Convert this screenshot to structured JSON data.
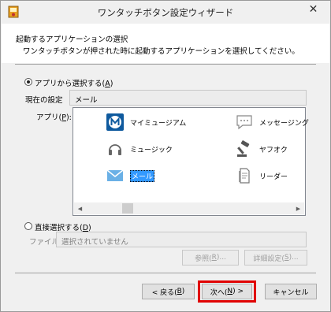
{
  "window": {
    "title": "ワンタッチボタン設定ウィザード",
    "close_glyph": "✕"
  },
  "header": {
    "title": "起動するアプリケーションの選択",
    "subtitle": "ワンタッチボタンが押された時に起動するアプリケーションを選択してください。"
  },
  "app_option": {
    "label": "アプリから選択する(",
    "accel": "A",
    "close": ")",
    "selected": true,
    "current_setting_label": "現在の設定",
    "current_setting_value": "メール",
    "app_label": "アプリ(",
    "app_accel": "P",
    "app_close": "):"
  },
  "app_list": {
    "items": [
      {
        "name": "マイミュージアム",
        "icon": "museum-icon"
      },
      {
        "name": "メッセージング",
        "icon": "messaging-icon"
      },
      {
        "name": "ミュージック",
        "icon": "headphones-icon"
      },
      {
        "name": "ヤフオク",
        "icon": "auction-icon"
      },
      {
        "name": "メール",
        "icon": "mail-icon",
        "selected": true
      },
      {
        "name": "リーダー",
        "icon": "reader-icon"
      }
    ]
  },
  "direct_option": {
    "label": "直接選択する(",
    "accel": "D",
    "close": ")",
    "selected": false,
    "file_label": "ファイル",
    "file_value": "選択されていません",
    "browse_label": "参照(",
    "browse_accel": "R",
    "browse_close": ")...",
    "detail_label": "詳細設定(",
    "detail_accel": "S",
    "detail_close": ")..."
  },
  "footer": {
    "back_label": "< 戻る(",
    "back_accel": "B",
    "back_close": ")",
    "next_label": "次へ(",
    "next_accel": "N",
    "next_close": ") >",
    "cancel_label": "キャンセル",
    "highlight_color": "#e00000"
  }
}
